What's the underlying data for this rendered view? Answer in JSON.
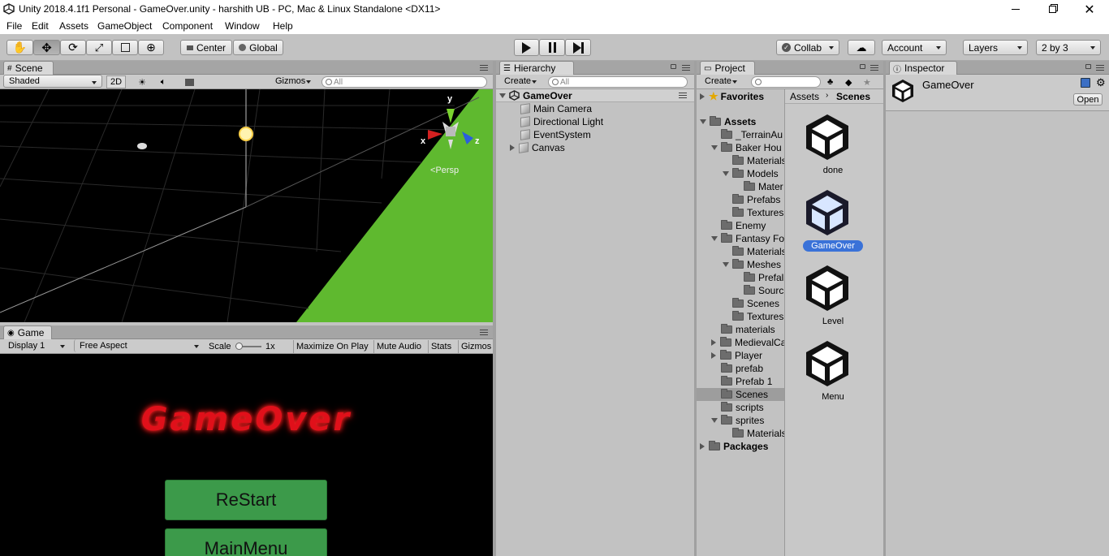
{
  "window": {
    "title": "Unity 2018.4.1f1 Personal - GameOver.unity - harshith UB - PC, Mac & Linux Standalone <DX11>"
  },
  "menu": [
    "File",
    "Edit",
    "Assets",
    "GameObject",
    "Component",
    "Window",
    "Help"
  ],
  "toolbar": {
    "pivot": "Center",
    "space": "Global",
    "collab": "Collab",
    "account": "Account",
    "layers": "Layers",
    "layout": "2 by 3"
  },
  "scene": {
    "tab": "Scene",
    "shading": "Shaded",
    "mode2d": "2D",
    "gizmos": "Gizmos",
    "search_placeholder": "All",
    "persp": "Persp",
    "axes": {
      "x": "x",
      "y": "y",
      "z": "z"
    }
  },
  "game": {
    "tab": "Game",
    "display": "Display 1",
    "aspect": "Free Aspect",
    "scale_label": "Scale",
    "scale_value": "1x",
    "maximize": "Maximize On Play",
    "mute": "Mute Audio",
    "stats": "Stats",
    "gizmos": "Gizmos",
    "headline": "GameOver",
    "restart": "ReStart",
    "mainmenu": "MainMenu"
  },
  "hierarchy": {
    "tab": "Hierarchy",
    "create": "Create",
    "search_placeholder": "All",
    "scene_name": "GameOver",
    "items": [
      "Main Camera",
      "Directional Light",
      "EventSystem",
      "Canvas"
    ]
  },
  "project": {
    "tab": "Project",
    "create": "Create",
    "favorites": "Favorites",
    "assets_root": "Assets",
    "tree": [
      "_TerrainAu",
      "Baker Hou",
      "Materials",
      "Models",
      "Mater",
      "Prefabs",
      "Textures",
      "Enemy",
      "Fantasy Fo",
      "Materials",
      "Meshes",
      "Prefal",
      "Sourc",
      "Scenes",
      "Textures",
      "materials",
      "MedievalCa",
      "Player",
      "prefab",
      "Prefab 1",
      "Scenes",
      "scripts",
      "sprites",
      "Materials"
    ],
    "packages": "Packages",
    "breadcrumb": [
      "Assets",
      "Scenes"
    ],
    "files": [
      "done",
      "GameOver",
      "Level",
      "Menu"
    ]
  },
  "inspector": {
    "tab": "Inspector",
    "object": "GameOver",
    "open": "Open"
  },
  "colors": {
    "accent": "#3a72d8",
    "green_ground": "#5fb92f",
    "button_green": "#3c9a4a",
    "gameover_red": "#e0101a"
  }
}
